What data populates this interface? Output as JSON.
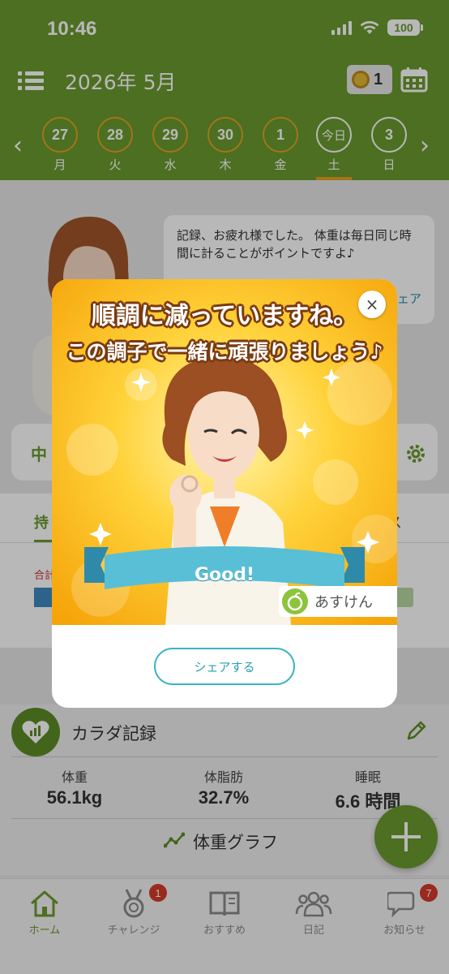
{
  "status_bar": {
    "time": "10:46",
    "battery": "100"
  },
  "header": {
    "title": "2026年 5月",
    "medal_count": "1",
    "days": [
      {
        "num": "27",
        "dow": "月"
      },
      {
        "num": "28",
        "dow": "火"
      },
      {
        "num": "29",
        "dow": "水"
      },
      {
        "num": "30",
        "dow": "木"
      },
      {
        "num": "1",
        "dow": "金"
      },
      {
        "num": "今日",
        "dow": "土"
      },
      {
        "num": "3",
        "dow": "日"
      }
    ]
  },
  "assistant": {
    "message": "記録、お疲れ様でした。 体重は毎日同じ時間に計ることがポイントですよ♪",
    "link": "ェア"
  },
  "background": {
    "search_label": "中",
    "meal_tab_left": "持",
    "meal_tab_right": "ス",
    "total_label": "合計",
    "right_label": "l"
  },
  "body_record": {
    "title": "カラダ記録",
    "stats": [
      {
        "label": "体重",
        "value": "56.1kg"
      },
      {
        "label": "体脂肪",
        "value": "32.7%"
      },
      {
        "label": "睡眠",
        "value": "6.6 時間"
      }
    ],
    "graph_link": "体重グラフ"
  },
  "modal": {
    "headline_1": "順調に減っていますね。",
    "headline_2": "この調子で一緒に頑張りましょう♪",
    "ribbon": "Good!",
    "brand": "あすけん",
    "share_button": "シェアする",
    "close": "×"
  },
  "tab_bar": {
    "items": [
      {
        "label": "ホーム",
        "badge": ""
      },
      {
        "label": "チャレンジ",
        "badge": "1"
      },
      {
        "label": "おすすめ",
        "badge": ""
      },
      {
        "label": "日記",
        "badge": ""
      },
      {
        "label": "お知らせ",
        "badge": "7"
      }
    ]
  },
  "colors": {
    "brand_green": "#6a9a2e",
    "accent_orange": "#e1a225",
    "share_teal": "#3bb5c2",
    "badge_red": "#d63a2a"
  }
}
